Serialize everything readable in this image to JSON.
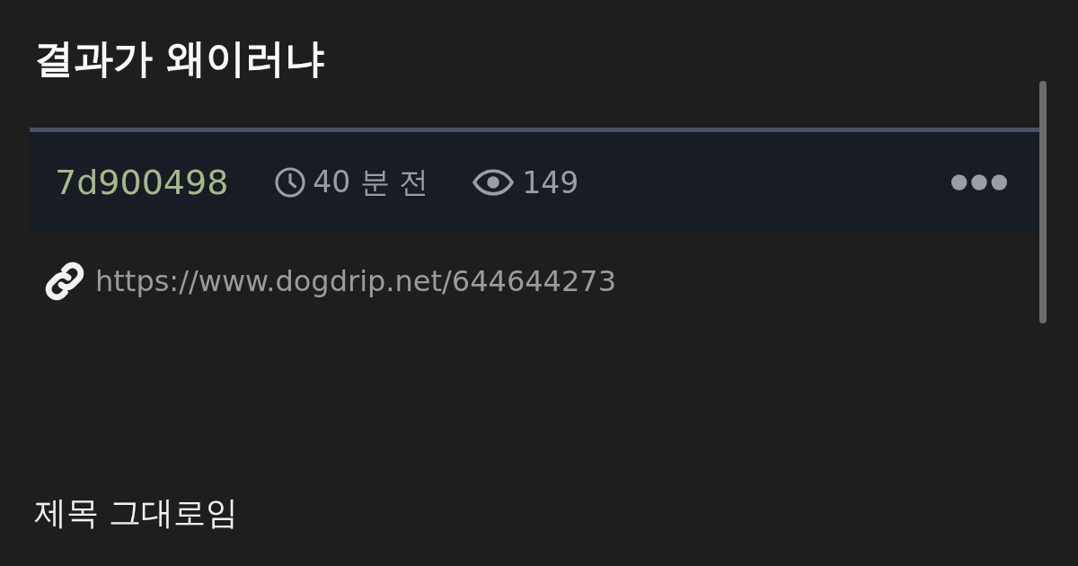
{
  "post": {
    "title": "결과가 왜이러냐",
    "author": "7d900498",
    "time": "40 분 전",
    "views": "149",
    "url": "https://www.dogdrip.net/644644273",
    "body": "제목 그대로임"
  }
}
